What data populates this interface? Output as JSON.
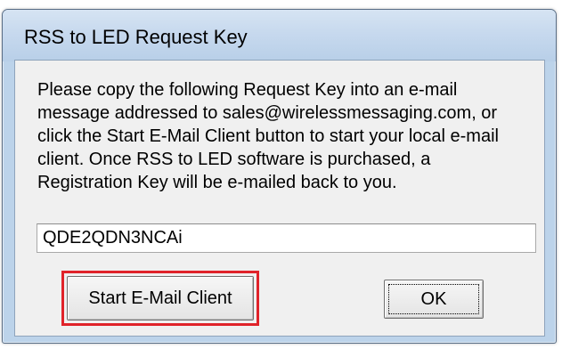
{
  "window": {
    "title": "RSS to LED Request Key"
  },
  "message": {
    "lines": [
      "Please copy the following Request Key into an e-mail",
      "message addressed to sales@wirelessmessaging.com, or",
      "click the Start E-Mail Client button to start your local e-mail",
      "client. Once RSS to LED software is purchased, a",
      "Registration Key will be e-mailed back to you."
    ]
  },
  "request_key": {
    "value": "QDE2QDN3NCAi"
  },
  "buttons": {
    "start_email_label": "Start E-Mail Client",
    "ok_label": "OK"
  },
  "colors": {
    "highlight": "#e0232a",
    "frame": "#bcd3ea",
    "client_bg": "#f0f0f0"
  }
}
